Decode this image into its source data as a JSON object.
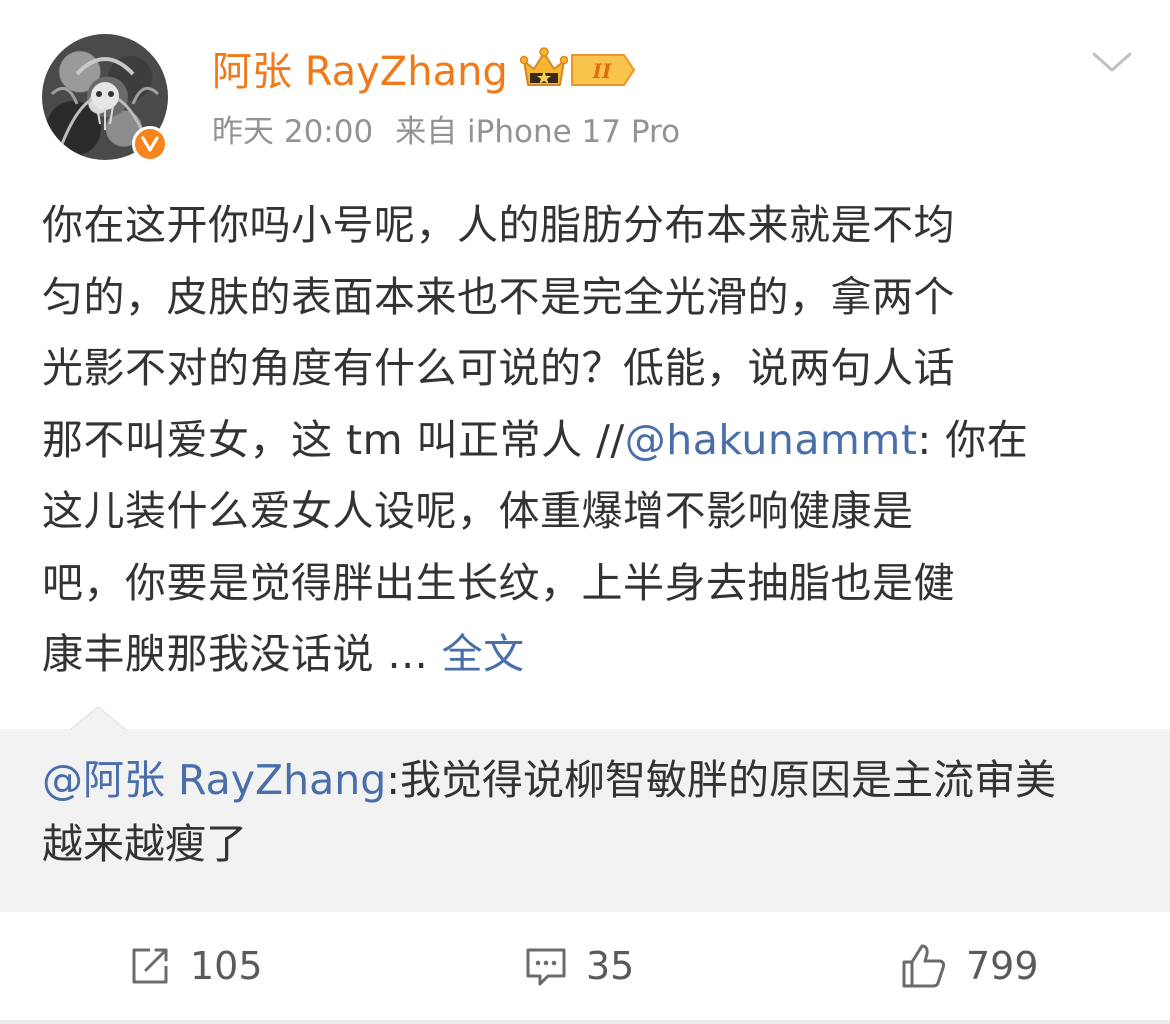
{
  "post": {
    "username": "阿张 RayZhang",
    "level": "II",
    "verified_mark": "v",
    "time": "昨天 20:00",
    "source": "来自 iPhone 17 Pro",
    "content": {
      "line1": "你在这开你吗小号呢，人的脂肪分布本来就是不均",
      "line2": "匀的，皮肤的表面本来也不是完全光滑的，拿两个",
      "line3": "光影不对的角度有什么可说的？低能，说两句人话",
      "line4_prefix": "那不叫爱女，这 tm 叫正常人 //",
      "line4_mention": "@hakunammt",
      "line4_suffix": ": 你在",
      "line5": "这儿装什么爱女人设呢，体重爆增不影响健康是",
      "line6": "吧，你要是觉得胖出生长纹，上半身去抽脂也是健",
      "line7_prefix": "康丰腴那我没话说 ... ",
      "line7_more": "全文"
    },
    "quote": {
      "mention": "@阿张 RayZhang",
      "line1_rest": ":我觉得说柳智敏胖的原因是主流审美",
      "line2": "越来越瘦了"
    }
  },
  "actions": {
    "repost_icon": "repost-icon",
    "repost_count": "105",
    "comment_icon": "comment-icon",
    "comment_count": "35",
    "like_icon": "thumbs-up-icon",
    "like_count": "799"
  },
  "colors": {
    "username": "#f07a1a",
    "link": "#4a6ea9",
    "meta": "#939393",
    "quote_bg": "#f2f2f2",
    "verified_badge": "#f7841c"
  }
}
